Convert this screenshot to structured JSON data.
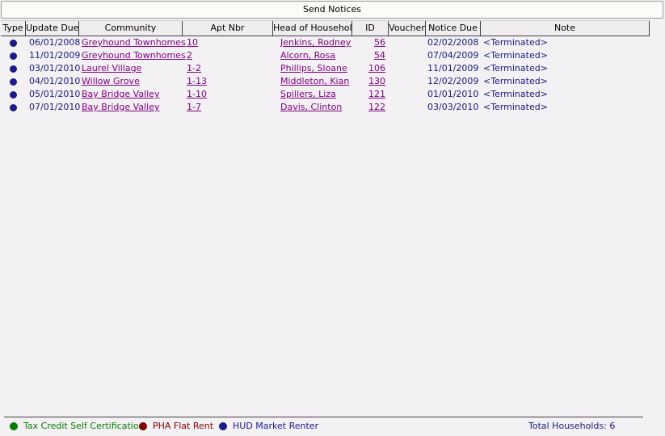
{
  "window": {
    "title": "Send Notices"
  },
  "table": {
    "columns": [
      "Type",
      "Update Due",
      "Community",
      "Apt Nbr",
      "Head of Household",
      "ID",
      "Voucher",
      "Notice Due",
      "Note"
    ],
    "rows": [
      {
        "type_color": "#1a1a8c",
        "update_due": "06/01/2008",
        "community": "Greyhound Townhomes",
        "apt": "10",
        "head": "Jenkins, Rodney",
        "id": "56",
        "voucher": "",
        "notice_due": "02/02/2008",
        "note": "<Terminated>"
      },
      {
        "type_color": "#1a1a8c",
        "update_due": "11/01/2009",
        "community": "Greyhound Townhomes",
        "apt": "2",
        "head": "Alcorn, Rosa",
        "id": "54",
        "voucher": "",
        "notice_due": "07/04/2009",
        "note": "<Terminated>"
      },
      {
        "type_color": "#1a1a8c",
        "update_due": "03/01/2010",
        "community": "Laurel Village",
        "apt": "1-2",
        "head": "Phillips, Sloane",
        "id": "106",
        "voucher": "",
        "notice_due": "11/01/2009",
        "note": "<Terminated>"
      },
      {
        "type_color": "#1a1a8c",
        "update_due": "04/01/2010",
        "community": "Willow Grove",
        "apt": "1-13",
        "head": "Middleton, Kian",
        "id": "130",
        "voucher": "",
        "notice_due": "12/02/2009",
        "note": "<Terminated>"
      },
      {
        "type_color": "#1a1a8c",
        "update_due": "05/01/2010",
        "community": "Bay Bridge Valley",
        "apt": "1-10",
        "head": "Spillers, Liza",
        "id": "121",
        "voucher": "",
        "notice_due": "01/01/2010",
        "note": "<Terminated>"
      },
      {
        "type_color": "#1a1a8c",
        "update_due": "07/01/2010",
        "community": "Bay Bridge Valley",
        "apt": "1-7",
        "head": "Davis, Clinton",
        "id": "122",
        "voucher": "",
        "notice_due": "03/03/2010",
        "note": "<Terminated>"
      }
    ]
  },
  "legend": {
    "tax_credit": {
      "label": "Tax Credit Self Certification",
      "color": "#008000"
    },
    "pha": {
      "label": "PHA Flat Rent",
      "color": "#800000"
    },
    "hud": {
      "label": "HUD Market Renter",
      "color": "#1a1a8c"
    }
  },
  "footer": {
    "total_label": "Total Households:",
    "total_value": "6"
  }
}
